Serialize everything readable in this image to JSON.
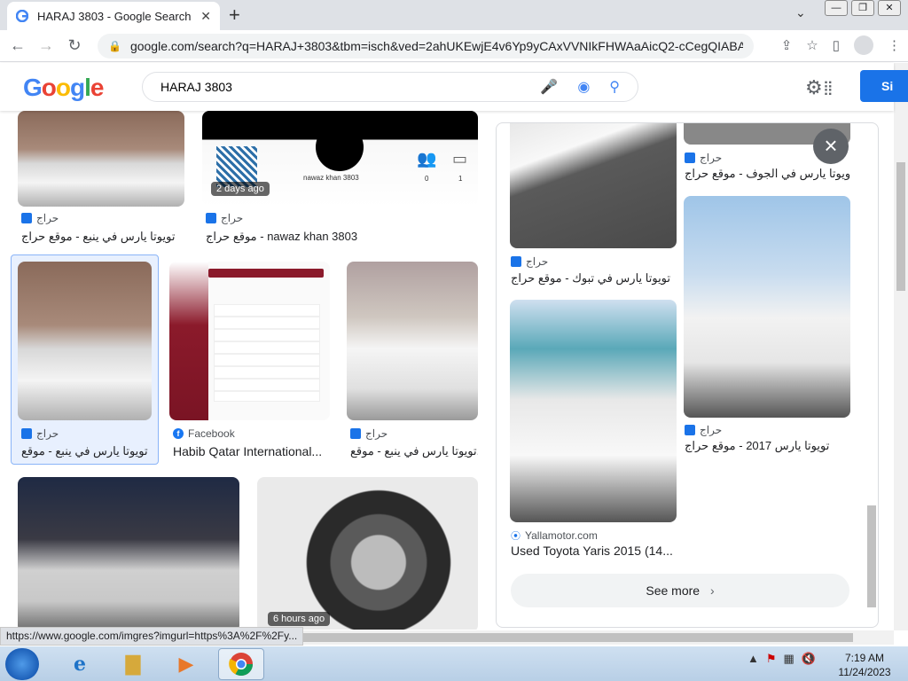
{
  "browser": {
    "tab_title": "HARAJ 3803 - Google Search",
    "url": "google.com/search?q=HARAJ+3803&tbm=isch&ved=2ahUKEwjE4v6Yp9yCAxVVNIkFHWAaAicQ2-cCegQIABAA..."
  },
  "header": {
    "logo": [
      "G",
      "o",
      "o",
      "g",
      "l",
      "e"
    ],
    "search_value": "HARAJ 3803",
    "signin_label": "Si"
  },
  "results": [
    {
      "source": "حراج",
      "title": "تويوتا يارس في ينبع - موقع حراج"
    },
    {
      "source": "حراج",
      "title": "موقع حراج - nawaz khan 3803",
      "badge": "2 days ago",
      "profile_name": "nawaz khan 3803",
      "stat1": "0",
      "stat2": "1"
    },
    {
      "source": "حراج",
      "title": "تويوتا يارس في ينبع - موقع ..."
    },
    {
      "source": "Facebook",
      "title": "Habib Qatar International..."
    },
    {
      "source": "حراج",
      "title": "تويوتا يارس في ينبع - موقع..."
    },
    {
      "source": "",
      "title": ""
    },
    {
      "source": "",
      "title": "",
      "badge": "6 hours ago"
    }
  ],
  "panel": {
    "items": [
      {
        "source": "حراج",
        "title": "تويوتا يارس في تبوك - موقع حراج"
      },
      {
        "source": "حراج",
        "title": "تويوتا يارس في الجوف - موقع حراج"
      },
      {
        "source": "حراج",
        "title": "تويوتا يارس 2017 - موقع حراج"
      },
      {
        "source": "Yallamotor.com",
        "title": "Used Toyota Yaris 2015 (14..."
      }
    ],
    "see_more": "See more"
  },
  "status_url": "https://www.google.com/imgres?imgurl=https%3A%2F%2Fy...",
  "taskbar": {
    "time": "7:19 AM",
    "date": "11/24/2023"
  }
}
